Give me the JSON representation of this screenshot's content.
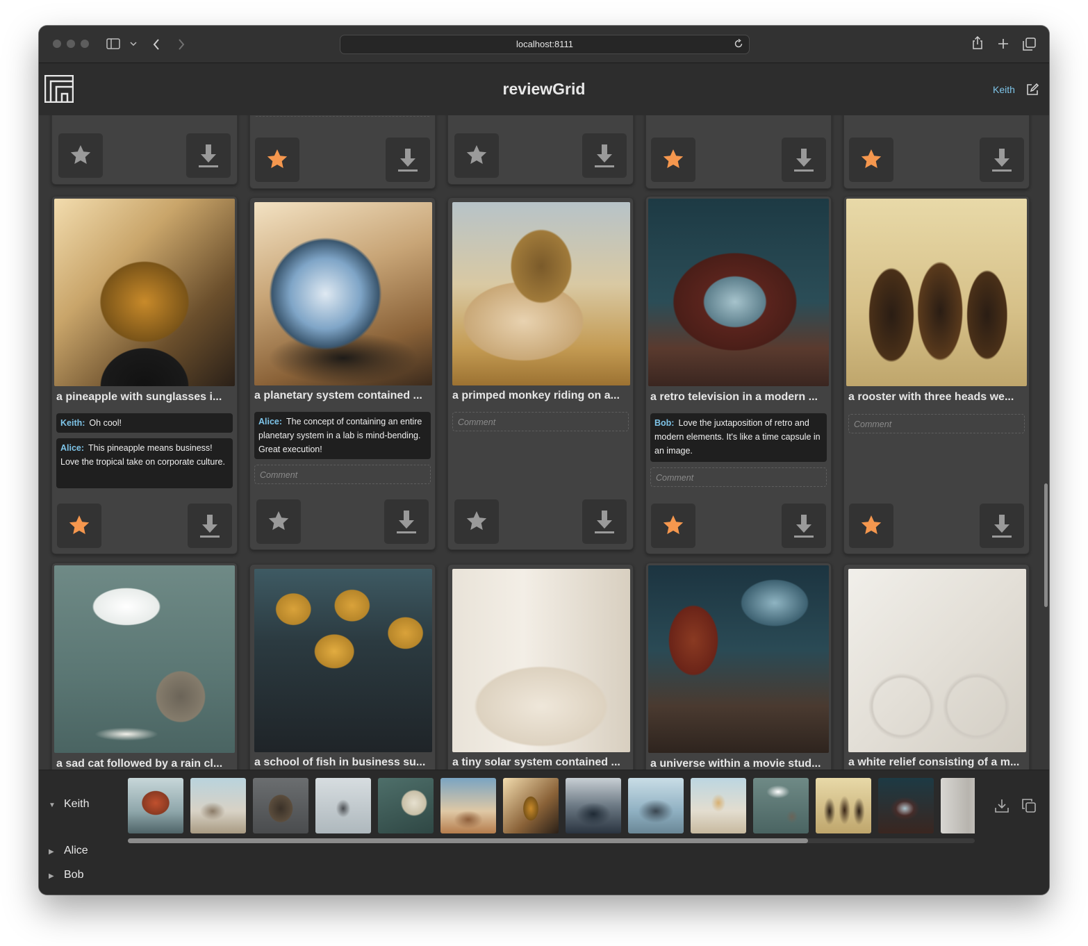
{
  "browser": {
    "url": "localhost:8111"
  },
  "app": {
    "title": "reviewGrid",
    "current_user": "Keith"
  },
  "colors": {
    "star_active": "#f5974e",
    "star_inactive": "#9a9a9a",
    "author": "#7ec4e8"
  },
  "top_row": [
    {
      "starred": false
    },
    {
      "starred": true
    },
    {
      "starred": false
    },
    {
      "starred": true
    },
    {
      "starred": true
    }
  ],
  "row2": [
    {
      "caption": "a pineapple with sunglasses i...",
      "starred": true,
      "comments": [
        {
          "author": "Keith:",
          "text": "Oh cool!"
        },
        {
          "author": "Alice:",
          "text": "This pineapple means business! Love the tropical take on corporate culture."
        }
      ],
      "comment_placeholder": ""
    },
    {
      "caption": "a planetary system contained ...",
      "starred": false,
      "comments": [
        {
          "author": "Alice:",
          "text": "The concept of containing an entire planetary system in a lab is mind-bending. Great execution!"
        }
      ],
      "comment_placeholder": "Comment"
    },
    {
      "caption": "a primped monkey riding on a...",
      "starred": false,
      "comments": [],
      "comment_placeholder": "Comment"
    },
    {
      "caption": "a retro television in a modern ...",
      "starred": true,
      "comments": [
        {
          "author": "Bob:",
          "text": "Love the juxtaposition of retro and modern elements. It's like a time capsule in an image."
        }
      ],
      "comment_placeholder": "Comment"
    },
    {
      "caption": "a rooster with three heads we...",
      "starred": true,
      "comments": [],
      "comment_placeholder": "Comment"
    }
  ],
  "row3": [
    {
      "caption": "a sad cat followed by a rain cl..."
    },
    {
      "caption": "a school of fish in business su..."
    },
    {
      "caption": "a tiny solar system contained ..."
    },
    {
      "caption": "a universe within a movie stud..."
    },
    {
      "caption": "a white relief consisting of a m..."
    }
  ],
  "reviewers": [
    {
      "name": "Keith",
      "expanded": true
    },
    {
      "name": "Alice",
      "expanded": false
    },
    {
      "name": "Bob",
      "expanded": false
    }
  ],
  "keith_strip_count": 14
}
